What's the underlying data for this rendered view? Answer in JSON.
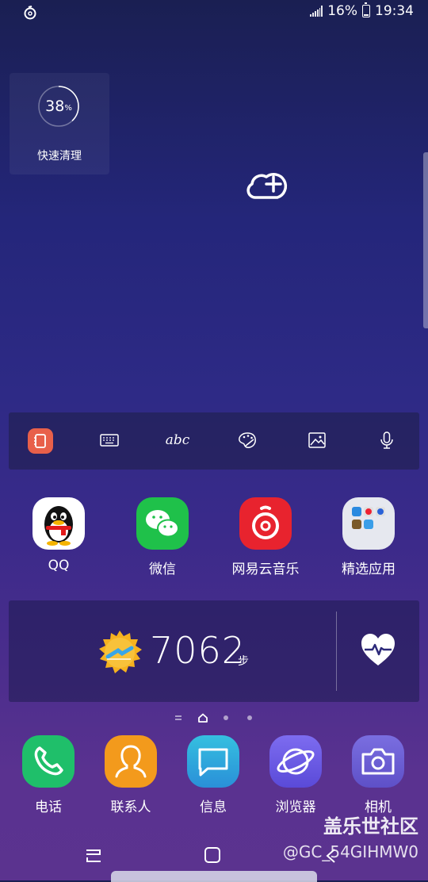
{
  "status": {
    "battery": "16%",
    "time": "19:34",
    "battery_level": 0.16
  },
  "quick_clean": {
    "percent": "38",
    "percent_sign": "%",
    "label": "快速清理",
    "level": 0.38
  },
  "toolbar": {
    "items": [
      "note-icon",
      "keyboard-icon",
      "handwriting-icon",
      "palette-icon",
      "image-icon",
      "microphone-icon"
    ],
    "handwriting_text": "abc"
  },
  "apps": [
    {
      "label": "QQ"
    },
    {
      "label": "微信"
    },
    {
      "label": "网易云音乐"
    },
    {
      "label": "精选应用"
    }
  ],
  "health": {
    "steps": "7062",
    "unit": "步"
  },
  "dock": [
    {
      "label": "电话",
      "color": "#1fbf6a"
    },
    {
      "label": "联系人",
      "color": "#f39a1c"
    },
    {
      "label": "信息",
      "color": "#2fa7d8"
    },
    {
      "label": "浏览器",
      "color": "#6a5ce0"
    },
    {
      "label": "相机",
      "color": "#6c5fd4"
    }
  ],
  "watermark": {
    "title": "盖乐世社区",
    "sub": "@GC_54GIHMW0"
  }
}
